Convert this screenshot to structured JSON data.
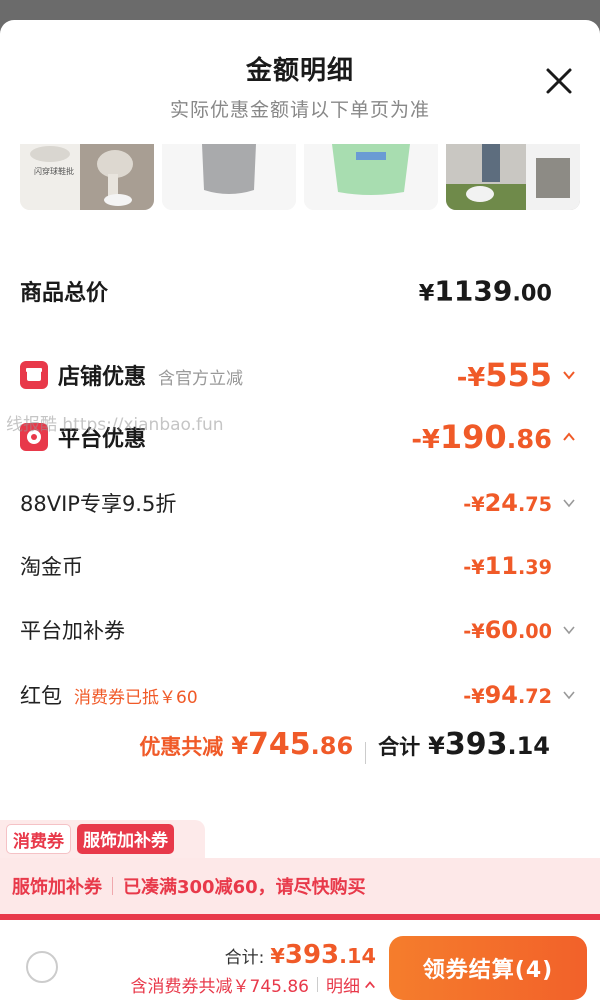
{
  "header": {
    "title": "金额明细",
    "subtitle": "实际优惠金额请以下单页为准"
  },
  "thumbs": {
    "first_caption": "闪穿球鞋批"
  },
  "watermark": "线报酷 https://xianbao.fun",
  "rows": {
    "total": {
      "label": "商品总价",
      "yen": "¥",
      "int": "1139",
      "dec": ".00"
    },
    "store": {
      "label": "店铺优惠",
      "note": "含官方立减",
      "yen": "-¥",
      "int": "555",
      "dec": ""
    },
    "platform": {
      "label": "平台优惠",
      "yen": "-¥",
      "int": "190",
      "dec": ".86"
    },
    "vip": {
      "label": "88VIP专享9.5折",
      "yen": "-¥",
      "int": "24",
      "dec": ".75"
    },
    "coins": {
      "label": "淘金币",
      "yen": "-¥",
      "int": "11",
      "dec": ".39"
    },
    "coupon": {
      "label": "平台加补券",
      "yen": "-¥",
      "int": "60",
      "dec": ".00"
    },
    "redpacket": {
      "label": "红包",
      "note": "消费券已抵￥60",
      "yen": "-¥",
      "int": "94",
      "dec": ".72"
    }
  },
  "summary": {
    "discount_label": "优惠共减",
    "discount_yen": "¥",
    "discount_int": "745",
    "discount_dec": ".86",
    "total_label": "合计",
    "total_yen": "¥",
    "total_int": "393",
    "total_dec": ".14"
  },
  "tags": [
    "消费券",
    "服饰加补券"
  ],
  "promo": {
    "name": "服饰加补券",
    "text": "已凑满300减60，请尽快购买"
  },
  "bottom": {
    "sum_label": "合计:",
    "sum_yen": "¥",
    "sum_int": "393",
    "sum_dec": ".14",
    "detail_text": "含消费券共减￥745.86",
    "detail_link": "明细",
    "checkout_label": "领券结算(4)"
  },
  "colors": {
    "accent": "#f05a28",
    "red": "#e8394a",
    "text": "#222222",
    "muted": "#888888"
  },
  "icons": [
    "close-icon",
    "store-icon",
    "platform-icon",
    "chevron-down-icon",
    "chevron-up-icon",
    "radio-icon"
  ]
}
